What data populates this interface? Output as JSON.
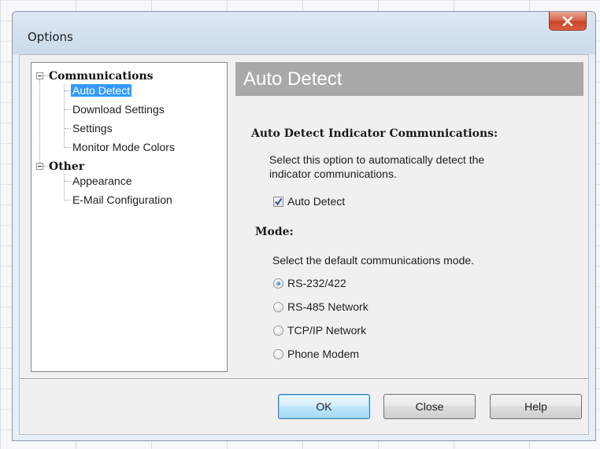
{
  "window": {
    "title": "Options",
    "close_icon": "close-icon"
  },
  "tree": {
    "groups": [
      {
        "label": "Communications",
        "expanded": true,
        "items": [
          {
            "label": "Auto Detect",
            "selected": true
          },
          {
            "label": "Download Settings",
            "selected": false
          },
          {
            "label": "Settings",
            "selected": false
          },
          {
            "label": "Monitor Mode Colors",
            "selected": false
          }
        ]
      },
      {
        "label": "Other",
        "expanded": true,
        "items": [
          {
            "label": "Appearance",
            "selected": false
          },
          {
            "label": "E-Mail Configuration",
            "selected": false
          }
        ]
      }
    ]
  },
  "pane": {
    "header": "Auto Detect",
    "auto_detect_section": {
      "title": "Auto Detect Indicator Communications:",
      "description_line1": "Select this option to automatically detect the",
      "description_line2": "indicator communications.",
      "checkbox_label": "Auto Detect",
      "checked": true
    },
    "mode_section": {
      "title": "Mode:",
      "description": "Select the default communications mode.",
      "options": [
        {
          "label": "RS-232/422",
          "checked": true
        },
        {
          "label": "RS-485 Network",
          "checked": false
        },
        {
          "label": "TCP/IP Network",
          "checked": false
        },
        {
          "label": "Phone Modem",
          "checked": false
        }
      ]
    }
  },
  "buttons": {
    "ok_label": "OK",
    "close_label": "Close",
    "help_label": "Help"
  },
  "colors": {
    "selection": "#3399ff",
    "header_bg": "#a9a9a9",
    "close_button": "#c9452a",
    "default_button_border": "#3c7fb1"
  }
}
